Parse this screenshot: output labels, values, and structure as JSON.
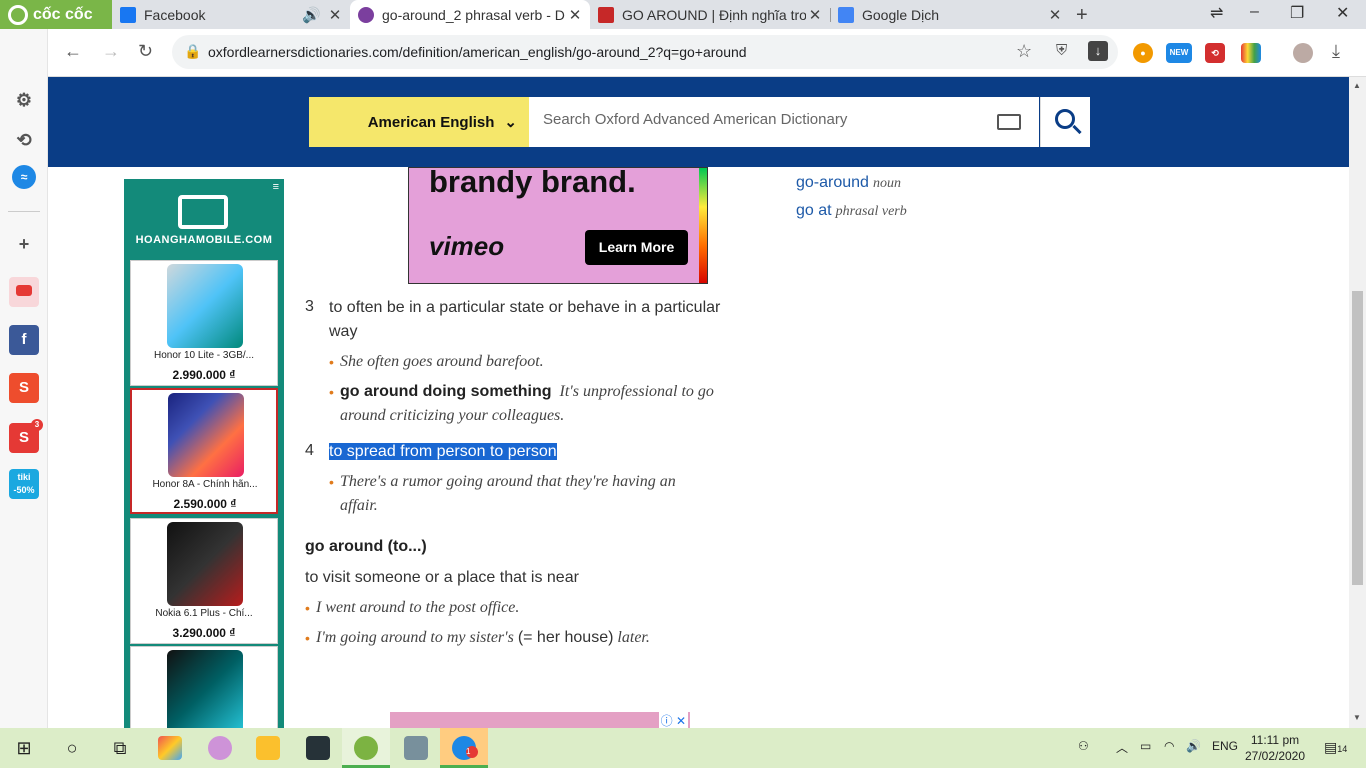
{
  "browser": {
    "brand": "cốc cốc",
    "tabs": [
      {
        "title": "Facebook",
        "favicon_color": "#1877f2"
      },
      {
        "title": "go-around_2 phrasal verb - D",
        "favicon_color": "#7b3f9e"
      },
      {
        "title": "GO AROUND | Định nghĩa tro",
        "favicon_color": "#c62828"
      },
      {
        "title": "Google Dịch",
        "favicon_color": "#4285f4"
      }
    ],
    "url": "oxfordlearnersdictionaries.com/definition/american_english/go-around_2?q=go+around",
    "extension_new_label": "NEW"
  },
  "rail": {
    "shopee_badge": "3",
    "tiki_label": "tiki",
    "tiki_discount": "-50%"
  },
  "header": {
    "language": "American English",
    "search_placeholder": "Search Oxford Advanced American Dictionary"
  },
  "side_ad": {
    "brand": "HOANGHAMOBILE.COM",
    "products": [
      {
        "name": "Honor 10 Lite - 3GB/...",
        "price": "2.990.000 ₫"
      },
      {
        "name": "Honor 8A - Chính hãn...",
        "price": "2.590.000 ₫"
      },
      {
        "name": "Nokia 6.1 Plus - Chí...",
        "price": "3.290.000 ₫"
      },
      {
        "name": "",
        "price": ""
      }
    ]
  },
  "vimeo_ad": {
    "headline": "brandy brand.",
    "logo": "vimeo",
    "cta": "Learn More"
  },
  "entry": {
    "senses": [
      {
        "number": "3",
        "definition_line1": "to often be in a particular state or behave in a particular",
        "definition_line2": "way",
        "example1": "She often goes around barefoot.",
        "collocation": "go around doing something",
        "example2_line1": "It's unprofessional to go",
        "example2_line2": "around criticizing your colleagues."
      },
      {
        "number": "4",
        "definition": "to spread from person to person",
        "example_line1": "There's a rumor going around that they're having an",
        "example_line2": "affair."
      }
    ],
    "phrase": {
      "headword": "go around (to...)",
      "definition": "to visit someone or a place that is near",
      "example1": "I went around to the post office.",
      "example2_a": "I'm going around to my sister's",
      "example2_b": "(= her house)",
      "example2_c": "later."
    }
  },
  "related": [
    {
      "word": "go-around",
      "pos": "noun"
    },
    {
      "word": "go at",
      "pos": "phrasal verb"
    }
  ],
  "taskbar": {
    "lang": "ENG",
    "time": "11:11 pm",
    "date": "27/02/2020",
    "notif_count": "14",
    "zalo_badge": "1"
  }
}
